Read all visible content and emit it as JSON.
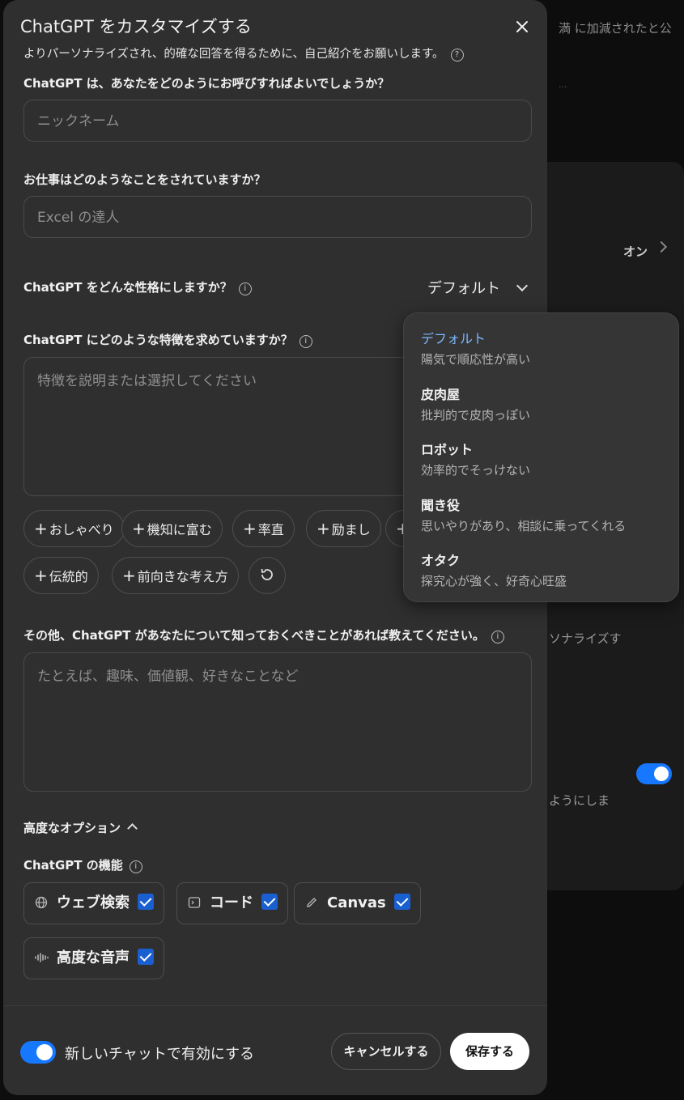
{
  "background": {
    "text_top": "満 に加減されたと公",
    "text_link": "...",
    "setting_value": "オン",
    "text_mid": "ソナライズす",
    "text_low": "ようにしま"
  },
  "modal": {
    "title": "ChatGPT をカスタマイズする",
    "subtitle": "よりパーソナライズされ、的確な回答を得るために、自己紹介をお願いします。",
    "nickname": {
      "label": "ChatGPT は、あなたをどのようにお呼びすればよいでしょうか？",
      "placeholder": "ニックネーム"
    },
    "job": {
      "label": "お仕事はどのようなことをされていますか？",
      "placeholder": "Excel の達人"
    },
    "personality": {
      "label": "ChatGPT をどんな性格にしますか？",
      "selected": "デフォルト"
    },
    "traits": {
      "label": "ChatGPT にどのような特徴を求めていますか？",
      "placeholder": "特徴を説明または選択してください",
      "chips": [
        "おしゃべり",
        "機知に富む",
        "率直",
        "励まし",
        "",
        "伝統的",
        "前向きな考え方"
      ]
    },
    "other": {
      "label": "その他、ChatGPT があなたについて知っておくべきことがあれば教えてください。",
      "placeholder": "たとえば、趣味、価値観、好きなことなど"
    },
    "advanced": {
      "label": "高度なオプション"
    },
    "features": {
      "label": "ChatGPT の機能",
      "items": [
        {
          "label": "ウェブ検索",
          "icon": "globe-icon",
          "checked": true
        },
        {
          "label": "コード",
          "icon": "terminal-icon",
          "checked": true
        },
        {
          "label": "Canvas",
          "icon": "pencil-icon",
          "checked": true
        },
        {
          "label": "高度な音声",
          "icon": "waveform-icon",
          "checked": true
        }
      ]
    },
    "footer": {
      "toggle_label": "新しいチャットで有効にする",
      "cancel": "キャンセルする",
      "save": "保存する"
    }
  },
  "personality_menu": [
    {
      "title": "デフォルト",
      "desc": "陽気で順応性が高い",
      "selected": true
    },
    {
      "title": "皮肉屋",
      "desc": "批判的で皮肉っぽい"
    },
    {
      "title": "ロボット",
      "desc": "効率的でそっけない"
    },
    {
      "title": "聞き役",
      "desc": "思いやりがあり、相談に乗ってくれる"
    },
    {
      "title": "オタク",
      "desc": "探究心が強く、好奇心旺盛"
    }
  ],
  "colors": {
    "accent": "#1677ff",
    "modal_bg": "#2f2f2f",
    "selected_item": "#7ab7ff"
  }
}
